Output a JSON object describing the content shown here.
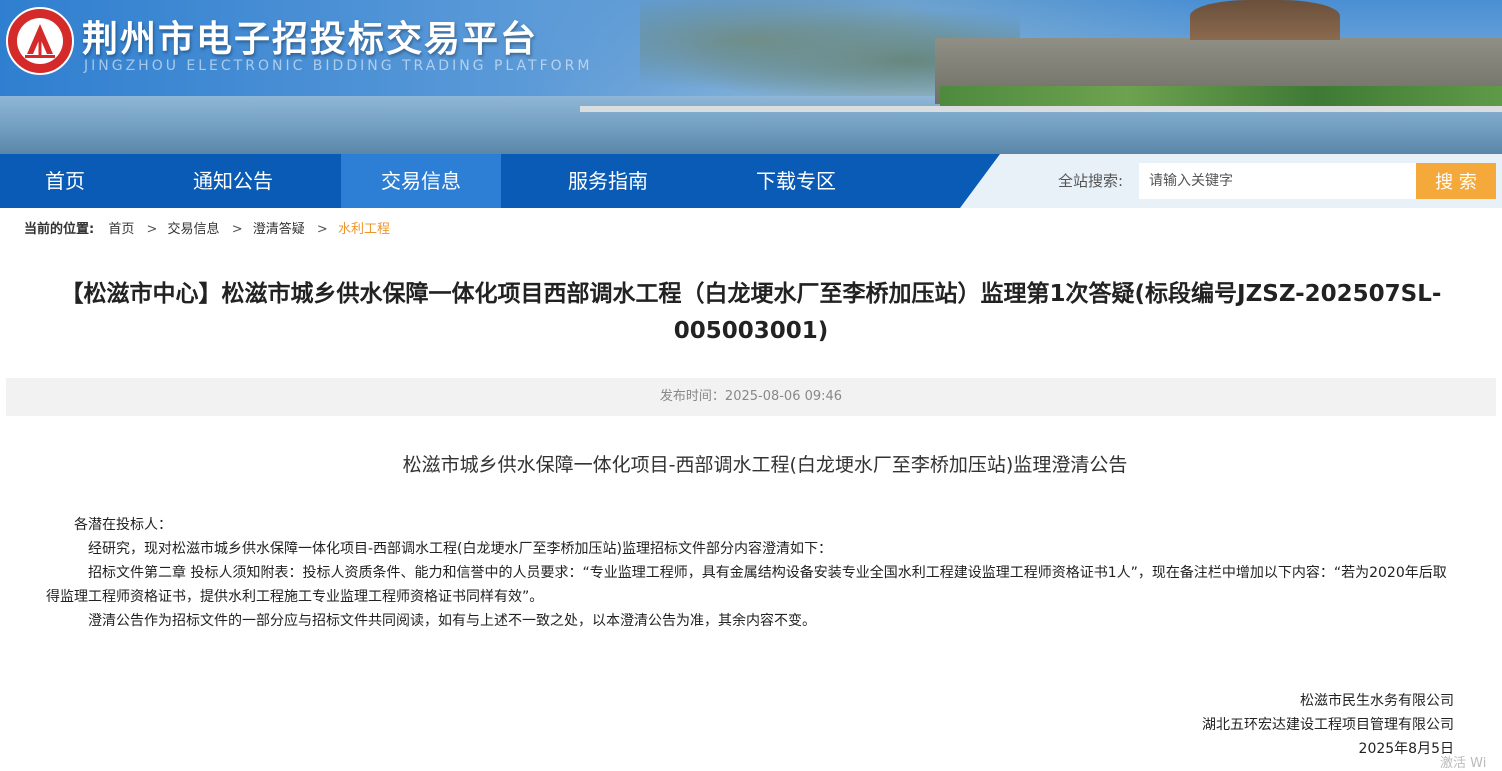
{
  "header": {
    "title": "荆州市电子招投标交易平台",
    "subtitle": "JINGZHOU ELECTRONIC BIDDING TRADING PLATFORM"
  },
  "nav": {
    "items": [
      {
        "label": "首页"
      },
      {
        "label": "通知公告"
      },
      {
        "label": "交易信息",
        "active": true
      },
      {
        "label": "服务指南"
      },
      {
        "label": "下载专区"
      }
    ]
  },
  "search": {
    "label": "全站搜索:",
    "placeholder": "请输入关键字",
    "button": "搜 索"
  },
  "breadcrumb": {
    "label": "当前的位置:",
    "items": [
      "首页",
      "交易信息",
      "澄清答疑"
    ],
    "current": "水利工程"
  },
  "article": {
    "title": "【松滋市中心】松滋市城乡供水保障一体化项目西部调水工程（白龙埂水厂至李桥加压站）监理第1次答疑(标段编号JZSZ-202507SL-005003001)",
    "published": "发布时间：2025-08-06 09:46",
    "notice_title": "松滋市城乡供水保障一体化项目-西部调水工程(白龙埂水厂至李桥加压站)监理澄清公告",
    "salutation": "各潜在投标人：",
    "paragraphs": [
      "经研究，现对松滋市城乡供水保障一体化项目-西部调水工程(白龙埂水厂至李桥加压站)监理招标文件部分内容澄清如下：",
      "招标文件第二章 投标人须知附表：投标人资质条件、能力和信誉中的人员要求：“专业监理工程师，具有金属结构设备安装专业全国水利工程建设监理工程师资格证书1人”，现在备注栏中增加以下内容：“若为2020年后取得监理工程师资格证书，提供水利工程施工专业监理工程师资格证书同样有效”。",
      "澄清公告作为招标文件的一部分应与招标文件共同阅读，如有与上述不一致之处，以本澄清公告为准，其余内容不变。"
    ],
    "signatories": [
      "松滋市民生水务有限公司",
      "湖北五环宏达建设工程项目管理有限公司"
    ],
    "date": "2025年8月5日"
  },
  "watermark": "激活 Wi"
}
